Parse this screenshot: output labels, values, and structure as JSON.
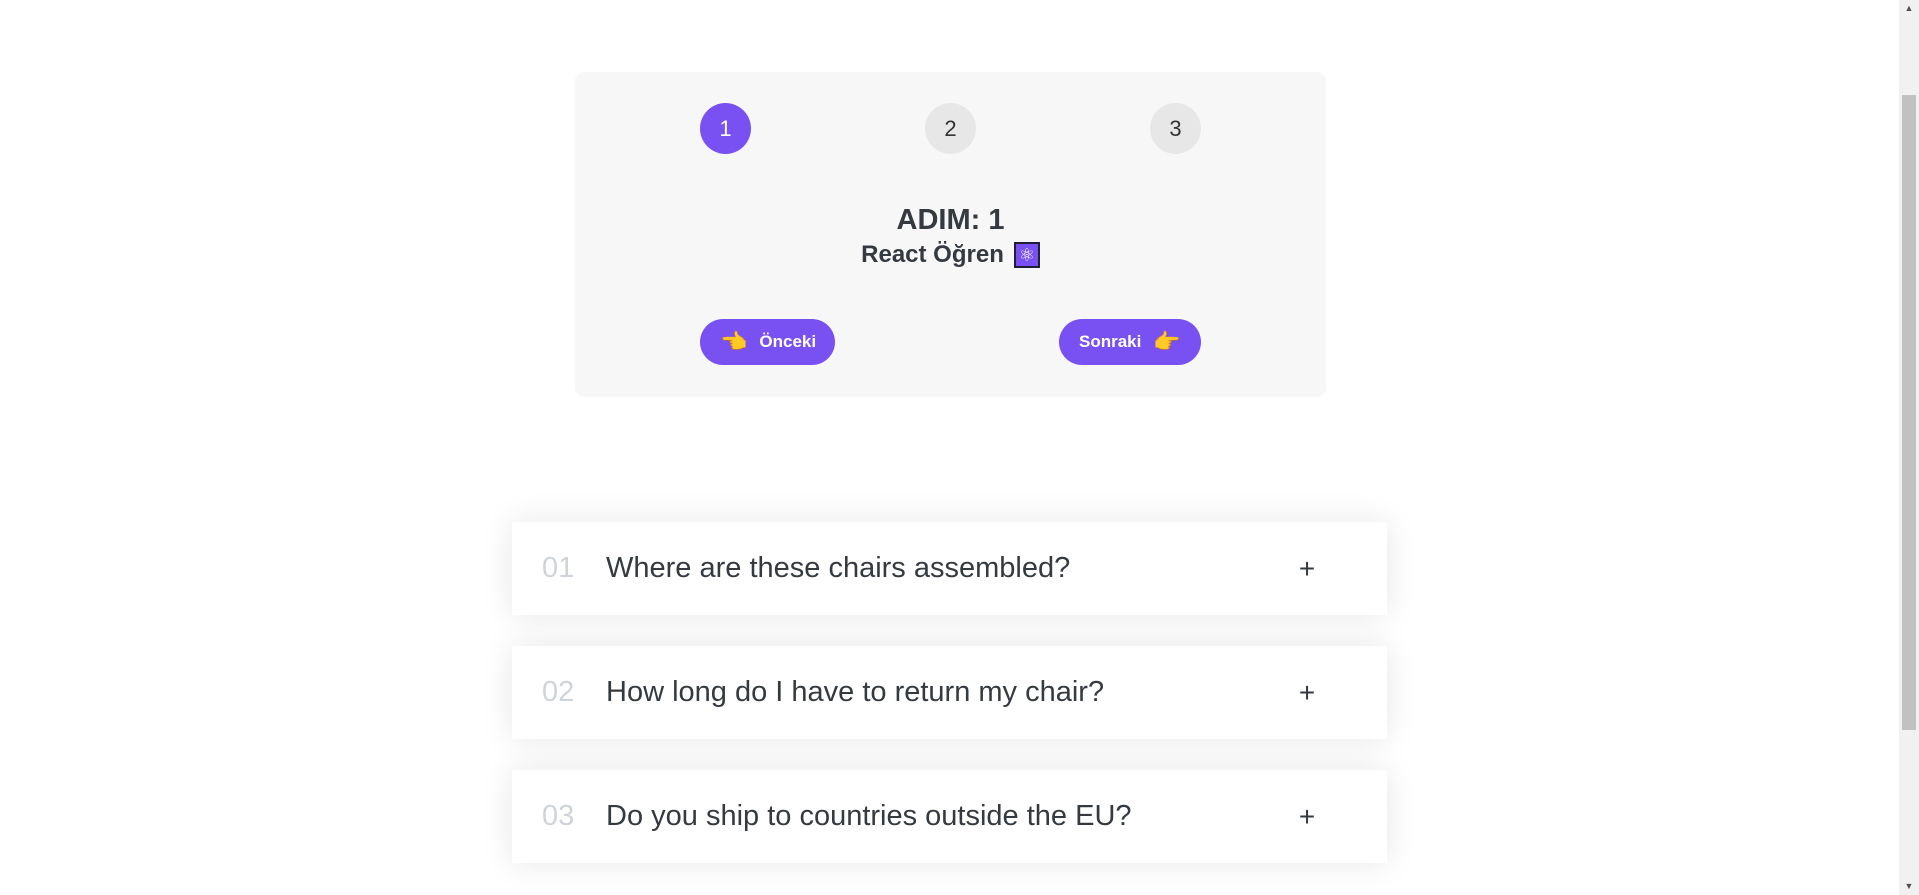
{
  "steps": {
    "numbers": [
      "1",
      "2",
      "3"
    ],
    "active_step": 1,
    "label": "ADIM: 1",
    "text": "React Öğren",
    "text_icon": "atom-icon",
    "prev_button": {
      "label": "Önceki",
      "icon": "hand-pointing-left-icon"
    },
    "next_button": {
      "label": "Sonraki",
      "icon": "hand-pointing-right-icon"
    },
    "accent_color": "#7950f2"
  },
  "accordion": {
    "items": [
      {
        "num": "01",
        "title": "Where are these chairs assembled?",
        "icon": "+"
      },
      {
        "num": "02",
        "title": "How long do I have to return my chair?",
        "icon": "+"
      },
      {
        "num": "03",
        "title": "Do you ship to countries outside the EU?",
        "icon": "+"
      }
    ]
  }
}
